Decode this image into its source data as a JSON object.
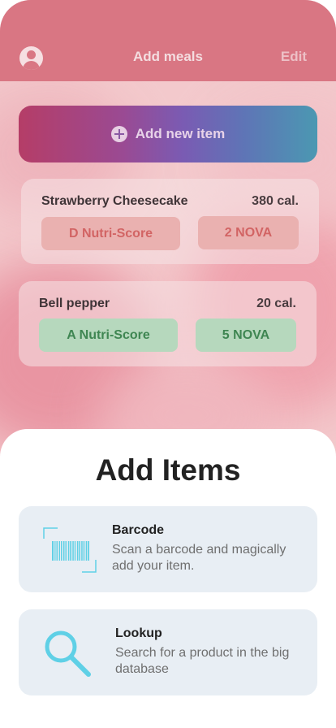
{
  "header": {
    "title": "Add meals",
    "edit_label": "Edit"
  },
  "add_button": {
    "label": "Add new item"
  },
  "meals": [
    {
      "name": "Strawberry Cheesecake",
      "calories": "380 cal.",
      "nutri_score": "D Nutri-Score",
      "nova": "2 NOVA",
      "tone": "red"
    },
    {
      "name": "Bell pepper",
      "calories": "20 cal.",
      "nutri_score": "A Nutri-Score",
      "nova": "5 NOVA",
      "tone": "green"
    }
  ],
  "sheet": {
    "title": "Add Items",
    "options": [
      {
        "title": "Barcode",
        "description": "Scan a barcode and magically add your item.",
        "icon": "barcode-icon"
      },
      {
        "title": "Lookup",
        "description": "Search for a product in the big database",
        "icon": "search-icon"
      }
    ]
  },
  "colors": {
    "accent_cyan": "#5fd0e6",
    "score_red": "#d26464",
    "score_green": "#3f8652"
  }
}
